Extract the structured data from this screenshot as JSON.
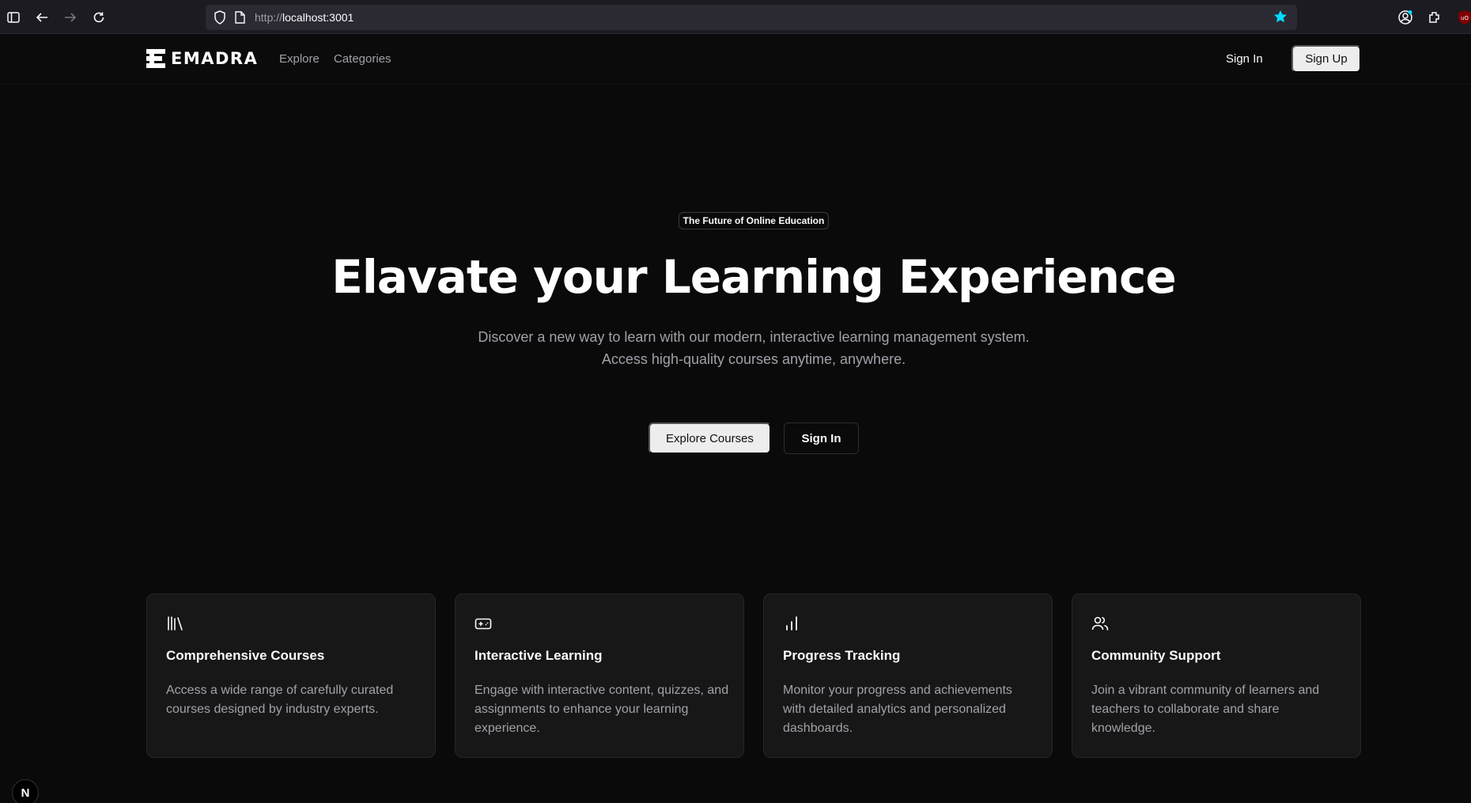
{
  "browser": {
    "url_prefix": "http://",
    "url_host": "localhost:3001",
    "icons": [
      "sidebar-icon",
      "back-icon",
      "forward-icon",
      "reload-icon",
      "shield-icon",
      "page-icon",
      "star-icon",
      "account-icon",
      "extensions-icon",
      "ublock-icon"
    ],
    "bookmark_color": "#00ddff"
  },
  "header": {
    "brand": "EMADRA",
    "nav": [
      "Explore",
      "Categories"
    ],
    "sign_in": "Sign In",
    "sign_up": "Sign Up"
  },
  "hero": {
    "badge": "The Future of Online Education",
    "title": "Elavate your Learning Experience",
    "subtitle_line1": "Discover a new way to learn with our modern, interactive learning management system.",
    "subtitle_line2": "Access high-quality courses anytime, anywhere.",
    "primary_button": "Explore Courses",
    "secondary_button": "Sign In"
  },
  "features": [
    {
      "icon": "library-icon",
      "title": "Comprehensive Courses",
      "description": "Access a wide range of carefully curated courses designed by industry experts."
    },
    {
      "icon": "gamepad-icon",
      "title": "Interactive Learning",
      "description": "Engage with interactive content, quizzes, and assignments to enhance your learning experience."
    },
    {
      "icon": "bar-chart-icon",
      "title": "Progress Tracking",
      "description": "Monitor your progress and achievements with detailed analytics and personalized dashboards."
    },
    {
      "icon": "users-icon",
      "title": "Community Support",
      "description": "Join a vibrant community of learners and teachers to collaborate and share knowledge."
    }
  ],
  "dev_badge": "N"
}
